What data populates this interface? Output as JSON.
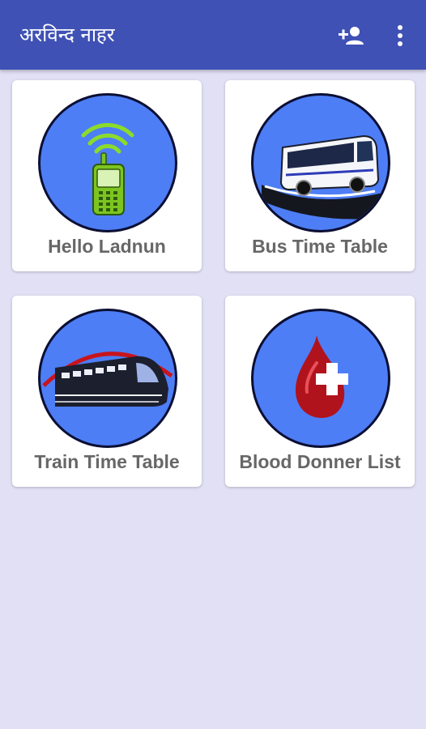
{
  "app_bar": {
    "title": "अरविन्द नाहर",
    "actions": [
      {
        "icon": "add-contact-icon"
      },
      {
        "icon": "more-vert-icon"
      }
    ],
    "color": "#3F51B5"
  },
  "theme": {
    "background": "#E1E0F4",
    "circle_fill": "#4D7EF6",
    "label_color": "#676767"
  },
  "tiles": [
    {
      "label": "Hello Ladnun",
      "icon": "mobile-phone-signal-icon"
    },
    {
      "label": "Bus Time Table",
      "icon": "bus-icon"
    },
    {
      "label": "Train Time Table",
      "icon": "train-icon"
    },
    {
      "label": "Blood Donner List",
      "icon": "blood-drop-plus-icon"
    }
  ]
}
